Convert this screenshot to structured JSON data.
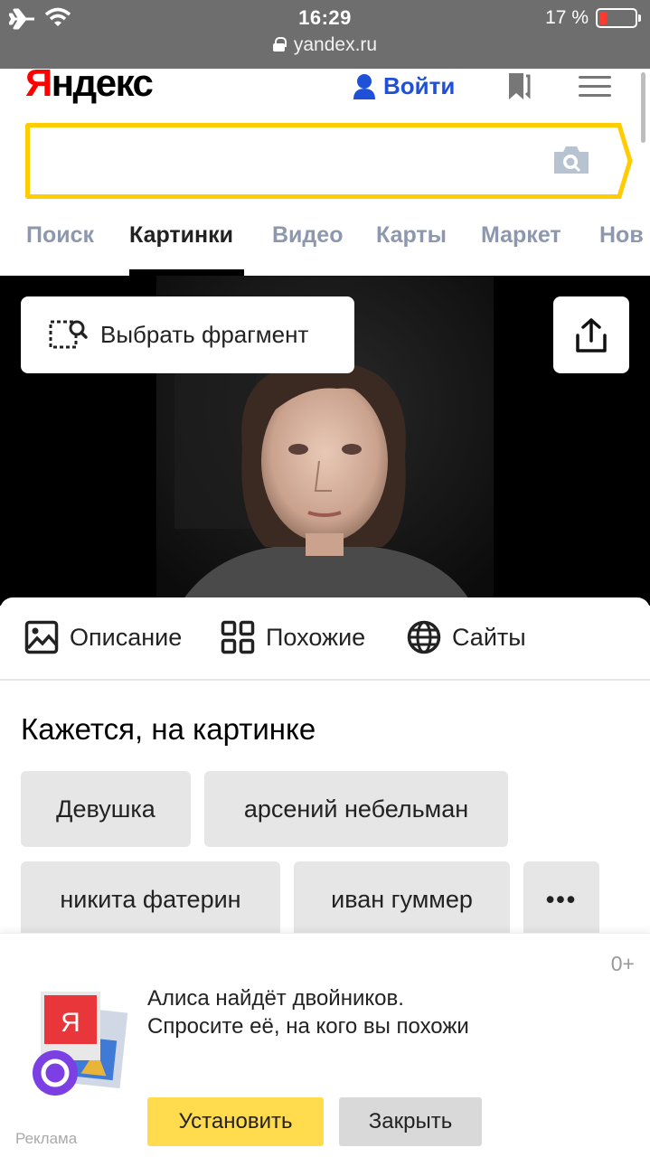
{
  "status": {
    "time": "16:29",
    "url": "yandex.ru",
    "battery": "17 %",
    "battery_level": 0.17
  },
  "header": {
    "logo_first": "Я",
    "logo_rest": "ндекс",
    "login_label": "Войти"
  },
  "search": {
    "value": ""
  },
  "tabs": [
    "Поиск",
    "Картинки",
    "Видео",
    "Карты",
    "Маркет",
    "Нов"
  ],
  "active_tab": "Картинки",
  "photo": {
    "fragment_label": "Выбрать фрагмент"
  },
  "panel": {
    "tabs": [
      "Описание",
      "Похожие",
      "Сайты"
    ],
    "section_title": "Кажется, на картинке",
    "chips": [
      "Девушка",
      "арсений небельман",
      "никита фатерин",
      "иван гуммер"
    ],
    "more_label": "•••"
  },
  "ad": {
    "age": "0+",
    "line1": "Алиса найдёт двойников.",
    "line2": "Спросите её, на кого вы похожи",
    "install_label": "Установить",
    "close_label": "Закрыть",
    "ad_label": "Реклама",
    "icon_letter": "Я"
  },
  "colors": {
    "status_bar": "#6e6e6e",
    "search_border": "#ffcc00",
    "login": "#1e50d8",
    "tab_inactive": "#8d98ae",
    "install_button": "#ffdb4d",
    "alice_purple": "#7b3fe4"
  },
  "icons": [
    "airplane-icon",
    "wifi-icon",
    "lock-icon",
    "battery-icon",
    "user-icon",
    "bookmark-icon",
    "menu-icon",
    "camera-icon",
    "crop-icon",
    "share-icon",
    "image-icon",
    "grid-icon",
    "globe-icon",
    "alice-icon"
  ]
}
